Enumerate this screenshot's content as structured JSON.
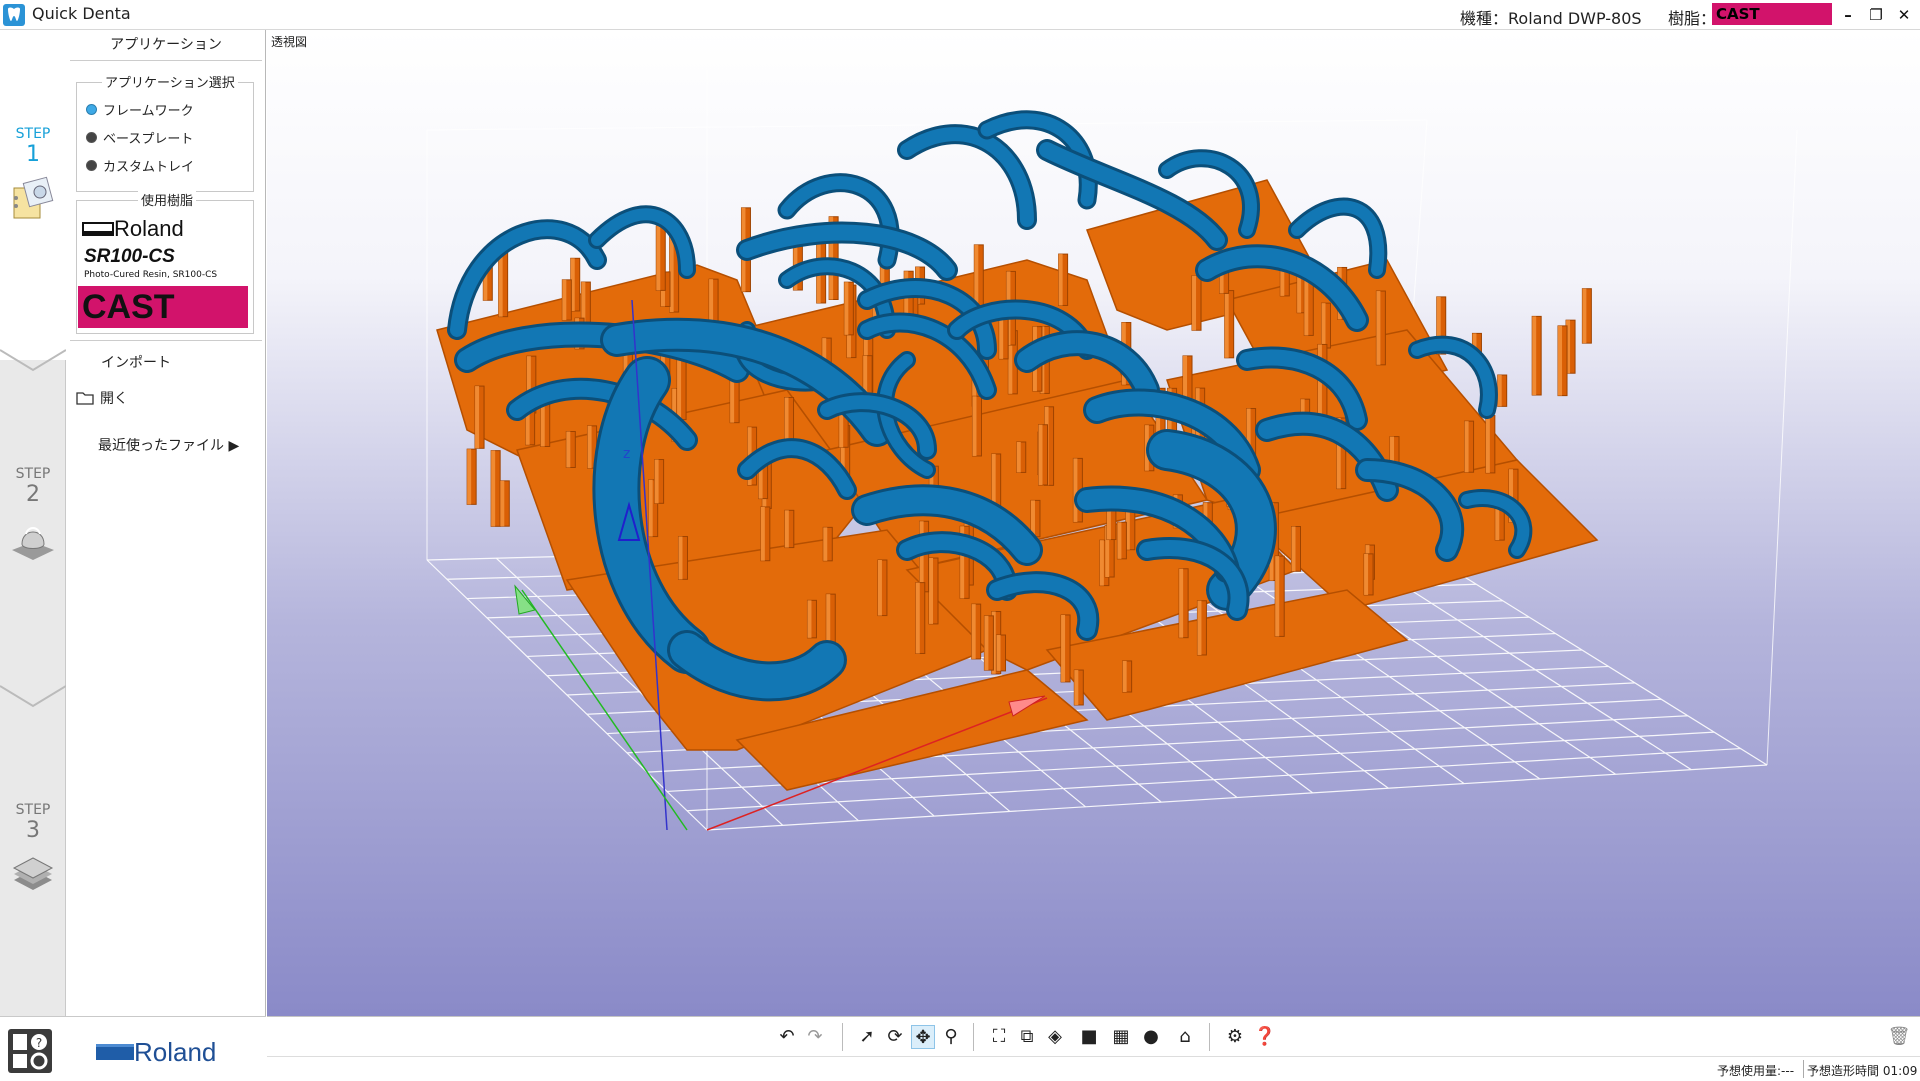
{
  "window": {
    "title": "Quick Denta",
    "machine_label": "機種：Roland DWP-80S",
    "resin_label": "樹脂：",
    "resin_value": "CAST",
    "minimize": "–",
    "restore": "❐",
    "close": "✕"
  },
  "steps": [
    {
      "word": "STEP",
      "num": "1"
    },
    {
      "word": "STEP",
      "num": "2"
    },
    {
      "word": "STEP",
      "num": "3"
    }
  ],
  "panel": {
    "title": "アプリケーション",
    "app_select_label": "アプリケーション選択",
    "options": [
      "フレームワーク",
      "ベースプレート",
      "カスタムトレイ"
    ],
    "selected_option": "フレームワーク",
    "resin_group_label": "使用樹脂",
    "resin_brand": "Roland",
    "resin_name": "SR100-CS",
    "resin_sub": "Photo-Cured Resin, SR100-CS",
    "resin_cast": "CAST",
    "import_label": "インポート",
    "open_label": "開く",
    "recent_label": "最近使ったファイル  ▶"
  },
  "footer": {
    "brand": "Roland"
  },
  "viewport": {
    "view_label": "透視図",
    "axis_z": "z"
  },
  "status": {
    "est_use": "予想使用量:---",
    "est_time": "予想造形時間 01:09"
  },
  "colors": {
    "accent": "#16a0d8",
    "cast": "#d2136b",
    "model": "#1170a8",
    "support": "#e36b0a"
  },
  "toolbar_icons": [
    "undo-icon",
    "redo-icon",
    "select-icon",
    "rotate-icon",
    "pan-icon",
    "zoom-icon",
    "fit-icon",
    "fit-selection-icon",
    "view-dropdown-icon",
    "cube-view-icon",
    "grid-icon",
    "shade-icon",
    "cap-icon",
    "settings-icon",
    "help-icon",
    "trash-icon"
  ]
}
